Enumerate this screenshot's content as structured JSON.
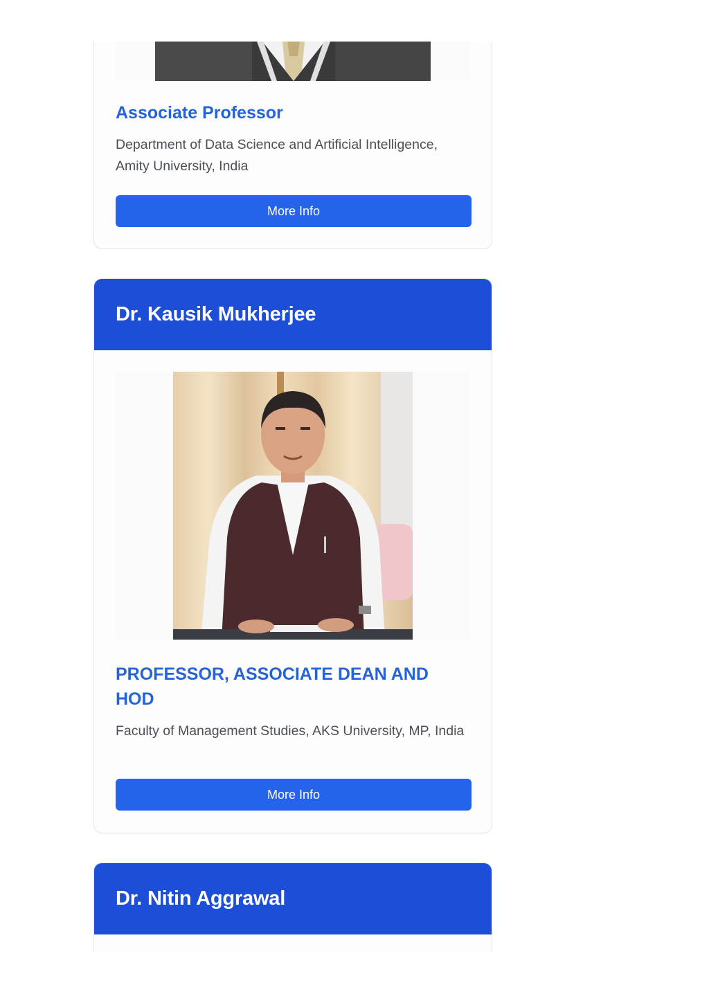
{
  "cards": [
    {
      "role": "Associate Professor",
      "department": "Department of Data Science and Artificial Intelligence, Amity University, India",
      "button_label": "More Info"
    },
    {
      "name": "Dr. Kausik Mukherjee",
      "role": "PROFESSOR, ASSOCIATE DEAN AND HOD",
      "department": "Faculty of Management Studies, AKS University, MP, India",
      "button_label": "More Info"
    },
    {
      "name": "Dr. Nitin Aggrawal"
    }
  ],
  "colors": {
    "header_bg": "#1d4ed8",
    "role_text": "#2563d6",
    "button_bg": "#2563eb"
  }
}
